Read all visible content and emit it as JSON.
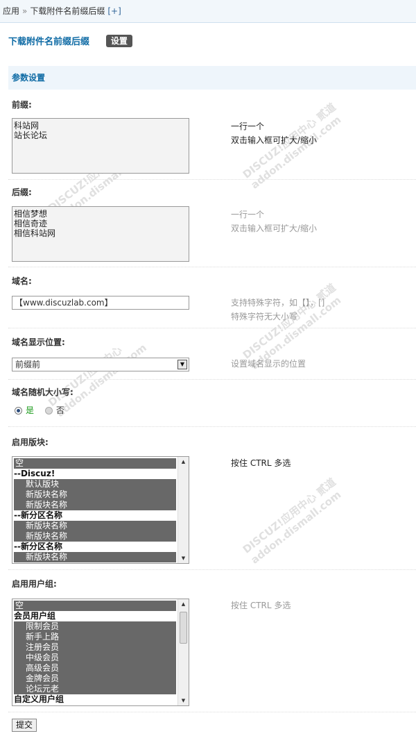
{
  "breadcrumb": {
    "root": "应用",
    "separator": "»",
    "current": "下载附件名前缀后缀",
    "plus": "[+]"
  },
  "header": {
    "title": "下载附件名前缀后缀",
    "tab": "设置"
  },
  "section": {
    "title": "参数设置"
  },
  "fields": {
    "prefix": {
      "label": "前缀:",
      "value": "科站网\n站长论坛",
      "tip_line1": "一行一个",
      "tip_line2": "双击输入框可扩大/缩小"
    },
    "suffix": {
      "label": "后缀:",
      "value": "相信梦想\n相信奇迹\n相信科站网",
      "tip_line1": "一行一个",
      "tip_line2": "双击输入框可扩大/缩小"
    },
    "domain": {
      "label": "域名:",
      "value": "【www.discuzlab.com】",
      "tip_line1": "支持特殊字符，如【】，[]",
      "tip_line2": "特殊字符无大小写"
    },
    "domain_position": {
      "label": "域名显示位置:",
      "selected": "前缀前",
      "tip": "设置域名显示的位置"
    },
    "domain_random_case": {
      "label": "域名随机大小写:",
      "yes": "是",
      "no": "否",
      "selected": "是"
    },
    "enabled_forums": {
      "label": "启用版块:",
      "tip": "按住 CTRL 多选",
      "options": [
        {
          "text": "空",
          "kind": "top",
          "selected": true
        },
        {
          "text": "--Discuz!",
          "kind": "group",
          "selected": false
        },
        {
          "text": "默认版块",
          "kind": "item",
          "selected": true
        },
        {
          "text": "新版块名称",
          "kind": "item",
          "selected": true
        },
        {
          "text": "新版块名称",
          "kind": "item",
          "selected": true
        },
        {
          "text": "--新分区名称",
          "kind": "group",
          "selected": false
        },
        {
          "text": "新版块名称",
          "kind": "item",
          "selected": true
        },
        {
          "text": "新版块名称",
          "kind": "item",
          "selected": true
        },
        {
          "text": "--新分区名称",
          "kind": "group",
          "selected": false
        },
        {
          "text": "新版块名称",
          "kind": "item",
          "selected": true
        }
      ]
    },
    "enabled_groups": {
      "label": "启用用户组:",
      "tip": "按住 CTRL 多选",
      "options": [
        {
          "text": "空",
          "kind": "top",
          "selected": true
        },
        {
          "text": "会员用户组",
          "kind": "group",
          "selected": false
        },
        {
          "text": "限制会员",
          "kind": "item",
          "selected": true
        },
        {
          "text": "新手上路",
          "kind": "item",
          "selected": true
        },
        {
          "text": "注册会员",
          "kind": "item",
          "selected": true
        },
        {
          "text": "中级会员",
          "kind": "item",
          "selected": true
        },
        {
          "text": "高级会员",
          "kind": "item",
          "selected": true
        },
        {
          "text": "金牌会员",
          "kind": "item",
          "selected": true
        },
        {
          "text": "论坛元老",
          "kind": "item",
          "selected": true
        },
        {
          "text": "自定义用户组",
          "kind": "group",
          "selected": false
        }
      ]
    }
  },
  "submit_label": "提交",
  "watermark": {
    "line1": "DISCUZ!应用中心",
    "line2": "addon.dismall.com",
    "mark": "贰道"
  },
  "colors": {
    "accent": "#0f6ba5",
    "selected_option": "#686868",
    "radio_yes": "#1a9a1a"
  }
}
